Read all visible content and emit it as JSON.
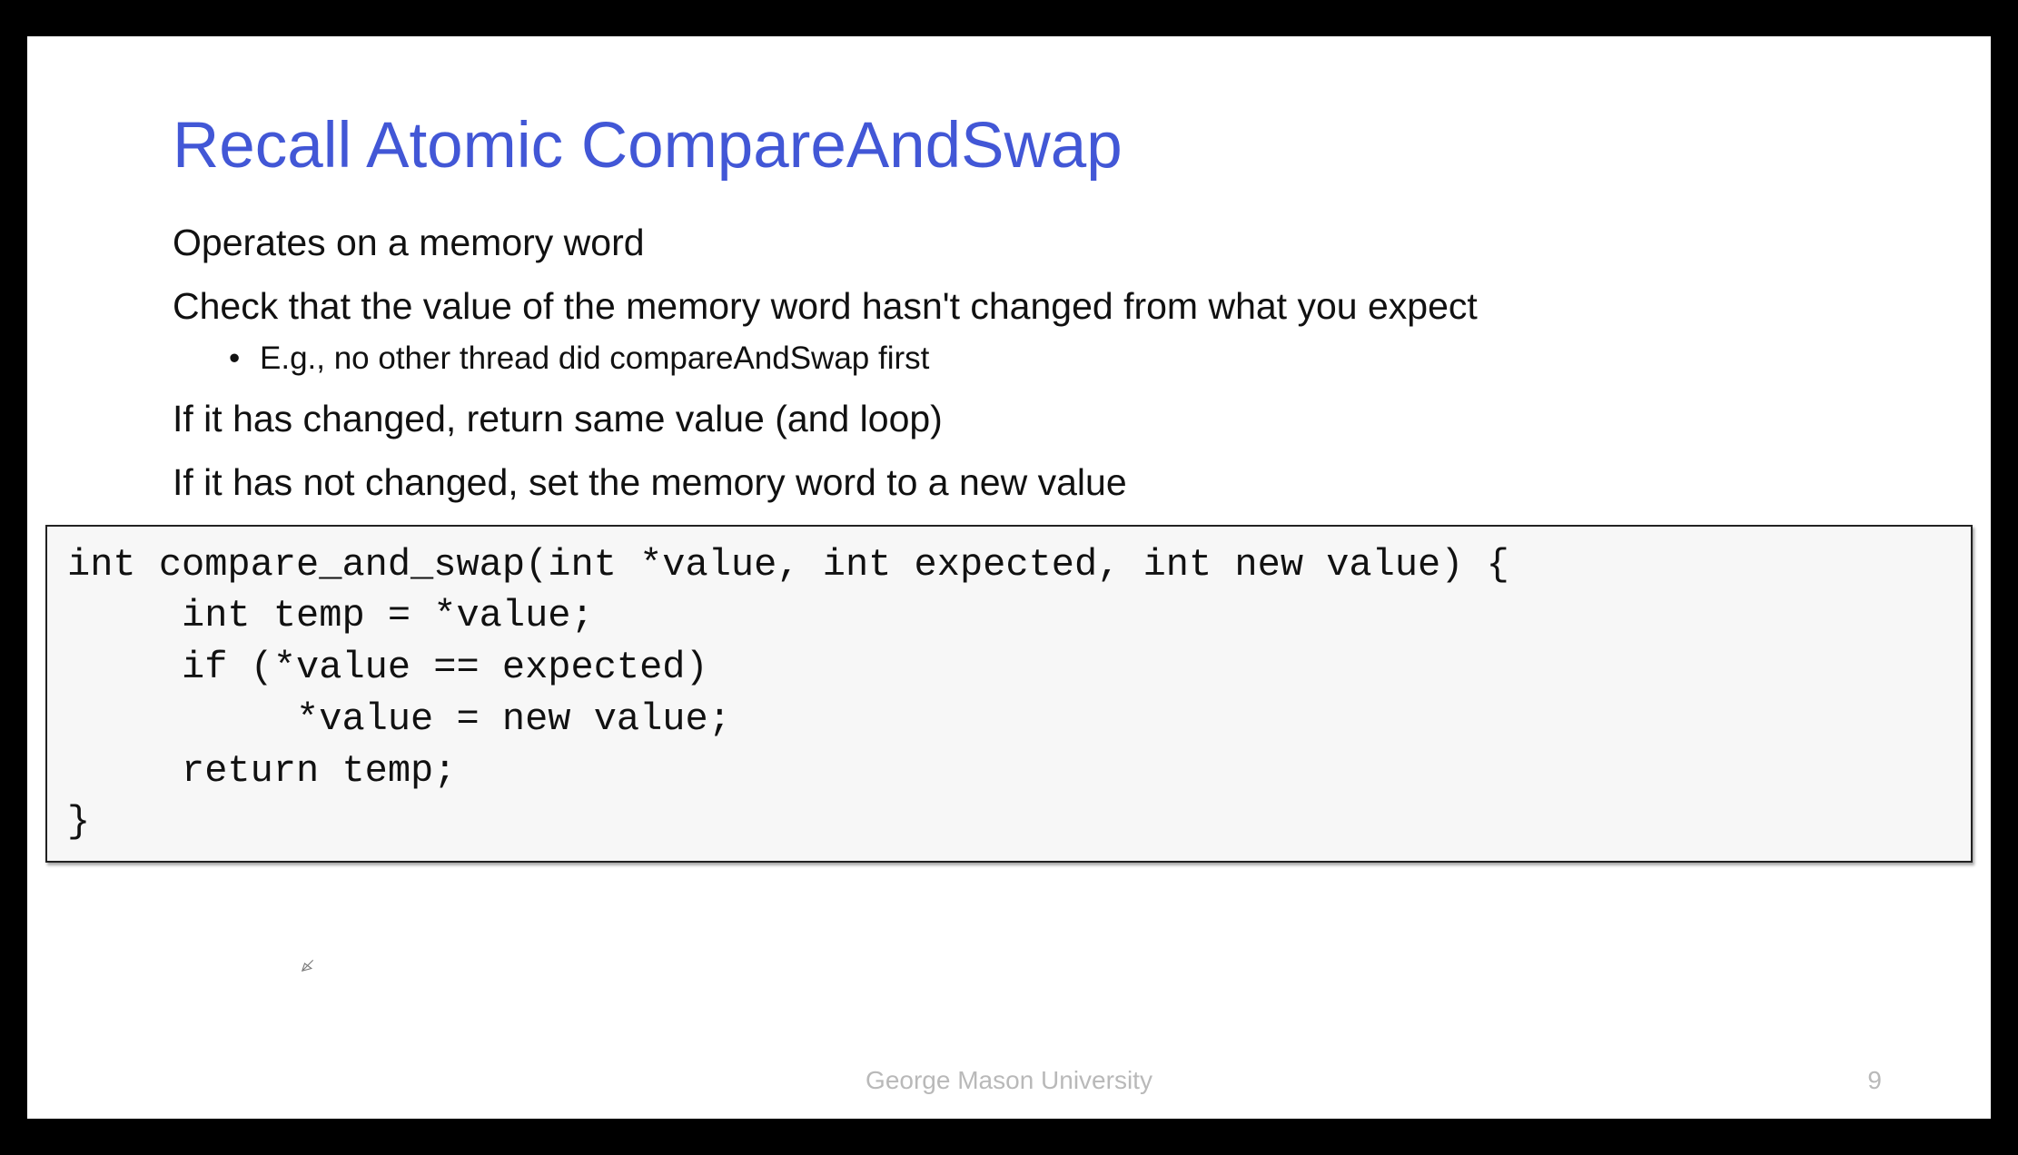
{
  "slide": {
    "title": "Recall Atomic CompareAndSwap",
    "lines": [
      "Operates on a memory word",
      "Check that the value of the memory word hasn't changed from what you expect"
    ],
    "sub_bullet": "E.g., no other thread did compareAndSwap first",
    "lines2": [
      "If it has changed, return same value (and loop)",
      "If it has not changed, set the memory word to a new value"
    ],
    "code": "int compare_and_swap(int *value, int expected, int new value) {\n     int temp = *value;\n     if (*value == expected)\n          *value = new value;\n     return temp;\n}",
    "footer_institution": "George Mason University",
    "footer_page": "9"
  }
}
